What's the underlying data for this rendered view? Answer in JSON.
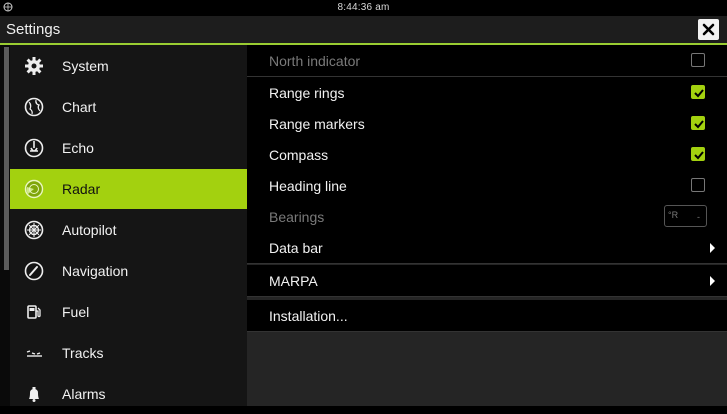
{
  "status_bar": {
    "time": "8:44:36 am"
  },
  "header": {
    "title": "Settings",
    "close_icon": "close-icon"
  },
  "sidebar": {
    "items": [
      {
        "label": "System",
        "icon": "gear-icon",
        "active": false
      },
      {
        "label": "Chart",
        "icon": "globe-icon",
        "active": false
      },
      {
        "label": "Echo",
        "icon": "echo-icon",
        "active": false
      },
      {
        "label": "Radar",
        "icon": "radar-icon",
        "active": true
      },
      {
        "label": "Autopilot",
        "icon": "helm-icon",
        "active": false
      },
      {
        "label": "Navigation",
        "icon": "compass-icon",
        "active": false
      },
      {
        "label": "Fuel",
        "icon": "fuel-pump-icon",
        "active": false
      },
      {
        "label": "Tracks",
        "icon": "track-icon",
        "active": false
      },
      {
        "label": "Alarms",
        "icon": "bell-icon",
        "active": false
      }
    ]
  },
  "settings": {
    "rows": [
      {
        "label": "North indicator",
        "control": "checkbox",
        "checked": false,
        "disabled": true
      },
      {
        "label": "Range rings",
        "control": "checkbox",
        "checked": true,
        "disabled": false
      },
      {
        "label": "Range markers",
        "control": "checkbox",
        "checked": true,
        "disabled": false
      },
      {
        "label": "Compass",
        "control": "checkbox",
        "checked": true,
        "disabled": false
      },
      {
        "label": "Heading line",
        "control": "checkbox",
        "checked": false,
        "disabled": false
      },
      {
        "label": "Bearings",
        "control": "select",
        "value": "°R",
        "disabled": true
      },
      {
        "label": "Data bar",
        "control": "submenu",
        "disabled": false
      },
      {
        "label": "MARPA",
        "control": "submenu",
        "disabled": false
      },
      {
        "label": "Installation...",
        "control": "none",
        "disabled": false
      }
    ]
  },
  "colors": {
    "accent": "#a3d10f",
    "background": "#000000",
    "panel": "#252525"
  }
}
